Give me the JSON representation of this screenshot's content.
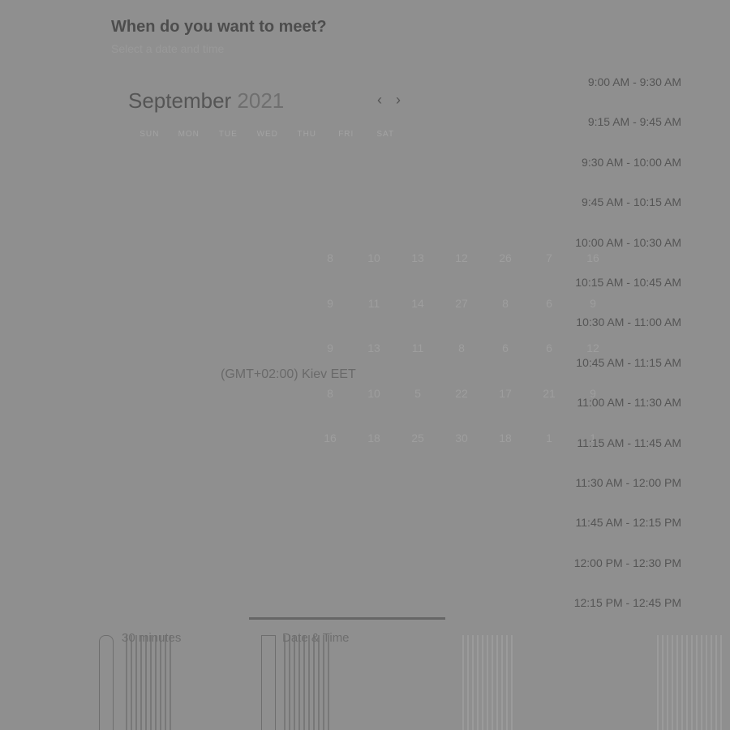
{
  "header": {
    "title": "When do you want to meet?",
    "subtitle": "Select a date and time"
  },
  "calendar": {
    "month": "September",
    "year": "2021",
    "prev_icon": "chevron-left-icon",
    "next_icon": "chevron-right-icon",
    "weekdays": [
      "SUN",
      "MON",
      "TUE",
      "WED",
      "THU",
      "FRI",
      "SAT"
    ],
    "days": [
      "8",
      "10",
      "13",
      "12",
      "26",
      "7",
      "16",
      "9",
      "11",
      "14",
      "27",
      "8",
      "6",
      "9",
      "9",
      "13",
      "11",
      "8",
      "6",
      "6",
      "12",
      "8",
      "10",
      "5",
      "22",
      "17",
      "21",
      "9",
      "16",
      "18",
      "25",
      "30",
      "18",
      "1",
      "1"
    ]
  },
  "timezone": "(GMT+02:00) Kiev  EET",
  "time_slots": [
    "9:00 AM - 9:30 AM",
    "9:15 AM - 9:45 AM",
    "9:30 AM - 10:00 AM",
    "9:45 AM - 10:15 AM",
    "10:00 AM - 10:30 AM",
    "10:15 AM - 10:45 AM",
    "10:30 AM - 11:00 AM",
    "10:45 AM - 11:15 AM",
    "11:00 AM - 11:30 AM",
    "11:15 AM - 11:45 AM",
    "11:30 AM - 12:00 PM",
    "11:45 AM - 12:15 PM",
    "12:00 PM - 12:30 PM",
    "12:15 PM - 12:45 PM"
  ],
  "footer": {
    "duration_label": "30 minutes",
    "duration_icon": "clock-icon",
    "datetime_label": "Date & Time",
    "datetime_icon": "calendar-icon"
  },
  "colors": {
    "overlay": "#8f8f8f",
    "text_dark": "#4d4d4d",
    "text_muted": "#999999"
  }
}
